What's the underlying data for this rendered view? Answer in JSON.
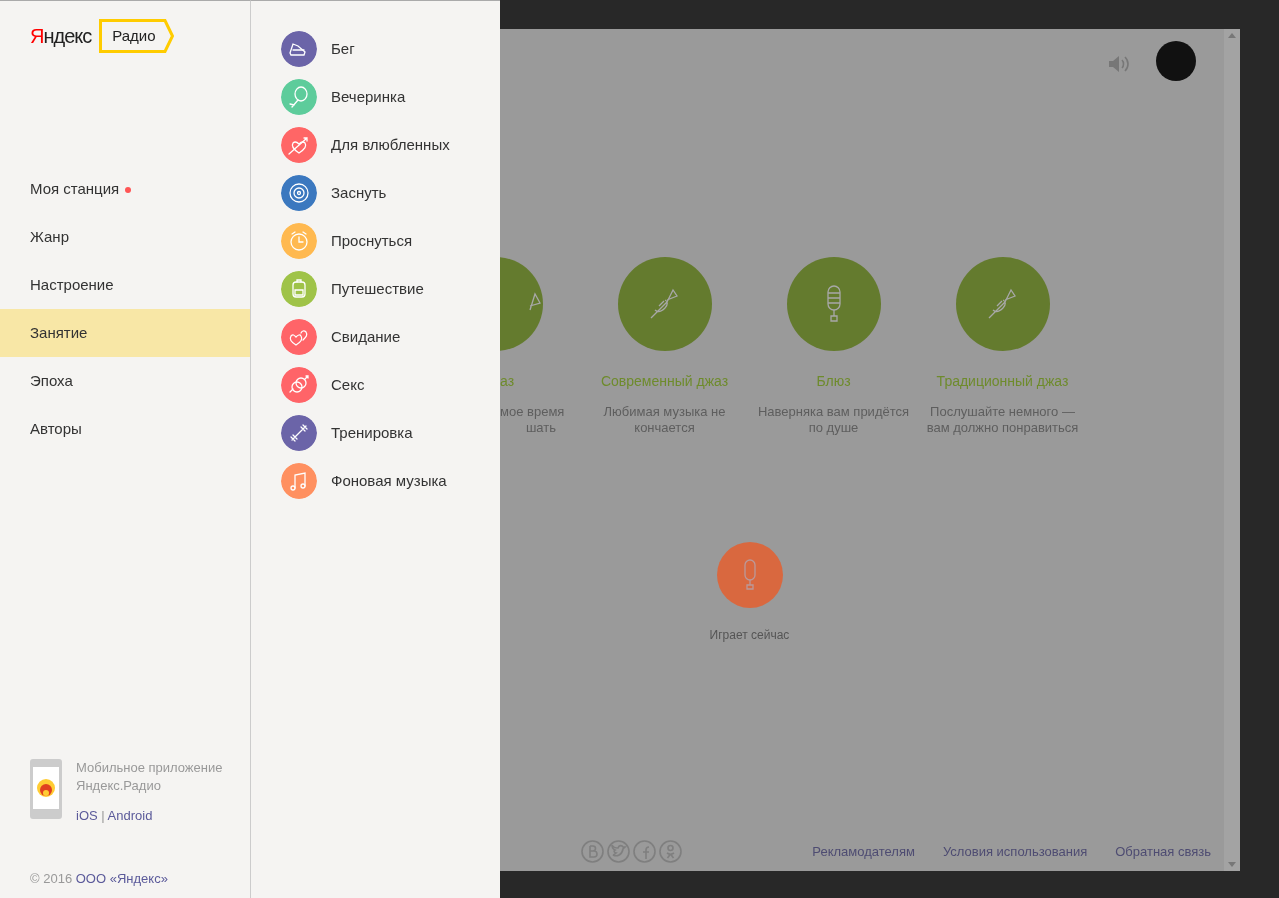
{
  "logo": {
    "brand": "Яндекс",
    "product": "Радио"
  },
  "nav": [
    {
      "label": "Моя станция",
      "selected": false,
      "unread": true
    },
    {
      "label": "Жанр",
      "selected": false,
      "unread": false
    },
    {
      "label": "Настроение",
      "selected": false,
      "unread": false
    },
    {
      "label": "Занятие",
      "selected": true,
      "unread": false
    },
    {
      "label": "Эпоха",
      "selected": false,
      "unread": false
    },
    {
      "label": "Авторы",
      "selected": false,
      "unread": false
    }
  ],
  "mobile_app": {
    "title_lines": [
      "Мобильное приложение",
      "Яндекс.Радио"
    ],
    "links": [
      "iOS",
      "Android"
    ],
    "separator": "|"
  },
  "copyright": {
    "text": "© 2016",
    "link": "ООО «Яндекс»"
  },
  "activities": [
    {
      "label": "Бег",
      "color": "#6b64a8"
    },
    {
      "label": "Вечеринка",
      "color": "#5dcc9b"
    },
    {
      "label": "Для влюбленных",
      "color": "#ff6666"
    },
    {
      "label": "Заснуть",
      "color": "#3b78bf"
    },
    {
      "label": "Проснуться",
      "color": "#ffb950"
    },
    {
      "label": "Путешествие",
      "color": "#9fc348"
    },
    {
      "label": "Свидание",
      "color": "#ff6468"
    },
    {
      "label": "Секс",
      "color": "#ff6468"
    },
    {
      "label": "Тренировка",
      "color": "#6b64a8"
    },
    {
      "label": "Фоновая музыка",
      "color": "#ff9060"
    }
  ],
  "stations": [
    {
      "kind": "partial",
      "title": "аз",
      "description_lines": [
        "мое время",
        "шать"
      ]
    },
    {
      "kind": "full",
      "title": "Современный джаз",
      "description_lines": [
        "Любимая музыка не",
        "кончается"
      ]
    },
    {
      "kind": "full",
      "title": "Блюз",
      "description_lines": [
        "Наверняка вам придётся",
        "по душе"
      ]
    },
    {
      "kind": "full",
      "title": "Традиционный джаз",
      "description_lines": [
        "Послушайте немного —",
        "вам должно понравиться"
      ]
    }
  ],
  "now_playing": {
    "label": "Играет сейчас"
  },
  "footer_links": [
    "Рекламодателям",
    "Условия использования",
    "Обратная связь"
  ]
}
